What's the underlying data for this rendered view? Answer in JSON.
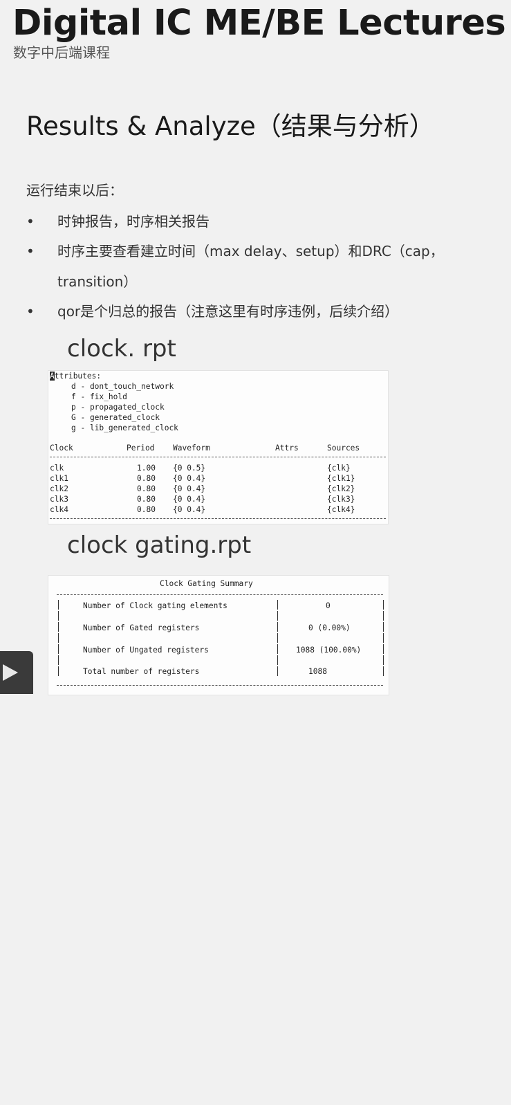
{
  "header": {
    "title": "Digital IC ME/BE Lectures",
    "subtitle": "数字中后端课程"
  },
  "slide": {
    "heading": "Results & Analyze（结果与分析）",
    "intro": "运行结束以后：",
    "bullet_symbol": "•",
    "bullets": [
      "时钟报告，时序相关报告",
      "时序主要查看建立时间（max delay、setup）和DRC（cap，transition）",
      "qor是个归总的报告（注意这里有时序违例，后续介绍）"
    ],
    "clock_report_title": "clock. rpt",
    "gating_report_title": "clock gating.rpt"
  },
  "clock_report": {
    "attributes_header_first": "A",
    "attributes_header_rest": "ttributes:",
    "attributes": [
      "d - dont_touch_network",
      "f - fix_hold",
      "p - propagated_clock",
      "G - generated_clock",
      "g - lib_generated_clock"
    ],
    "columns": [
      "Clock",
      "Period",
      "Waveform",
      "Attrs",
      "Sources"
    ],
    "rows": [
      {
        "clock": "clk",
        "period": "1.00",
        "waveform": "{0 0.5}",
        "attrs": "",
        "sources": "{clk}"
      },
      {
        "clock": "clk1",
        "period": "0.80",
        "waveform": "{0 0.4}",
        "attrs": "",
        "sources": "{clk1}"
      },
      {
        "clock": "clk2",
        "period": "0.80",
        "waveform": "{0 0.4}",
        "attrs": "",
        "sources": "{clk2}"
      },
      {
        "clock": "clk3",
        "period": "0.80",
        "waveform": "{0 0.4}",
        "attrs": "",
        "sources": "{clk3}"
      },
      {
        "clock": "clk4",
        "period": "0.80",
        "waveform": "{0 0.4}",
        "attrs": "",
        "sources": "{clk4}"
      }
    ]
  },
  "gating_report": {
    "title": "Clock Gating Summary",
    "rows": [
      {
        "label": "Number of Clock gating elements",
        "value": "0"
      },
      {
        "label": "Number of Gated registers",
        "value": "0 (0.00%)"
      },
      {
        "label": "Number of Ungated registers",
        "value": "1088 (100.00%)"
      },
      {
        "label": "Total number of registers",
        "value": "1088"
      }
    ]
  },
  "player": {
    "play_icon": "play-icon"
  }
}
